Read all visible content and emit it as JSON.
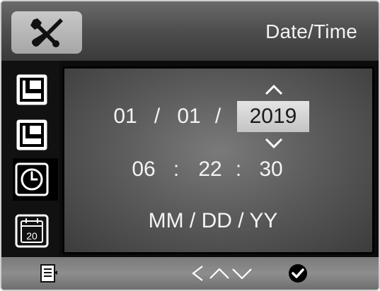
{
  "header": {
    "title": "Date/Time",
    "settings_icon": "tools-icon"
  },
  "sidebar": {
    "items": [
      {
        "icon": "layout-icon",
        "selected": false
      },
      {
        "icon": "layout-icon",
        "selected": false
      },
      {
        "icon": "clock-icon",
        "selected": true
      },
      {
        "icon": "calendar-icon",
        "selected": false,
        "icon_text": "20"
      }
    ]
  },
  "datetime": {
    "date": {
      "month": "01",
      "day": "01",
      "year": "2019",
      "separator": "/"
    },
    "time": {
      "hour": "06",
      "minute": "22",
      "second": "30",
      "separator": ":"
    },
    "format": "MM / DD / YY",
    "selected_field": "year"
  },
  "bottombar": {
    "icons": [
      "menu-icon",
      "chevron-left-icon",
      "chevron-up-icon",
      "chevron-down-icon",
      "checkmark-icon"
    ]
  },
  "colors": {
    "screen_bg": "#0c0c0c",
    "text": "#f4f4f4",
    "selected_bg": "#d4d4d4",
    "selected_text": "#1a1a1a"
  }
}
